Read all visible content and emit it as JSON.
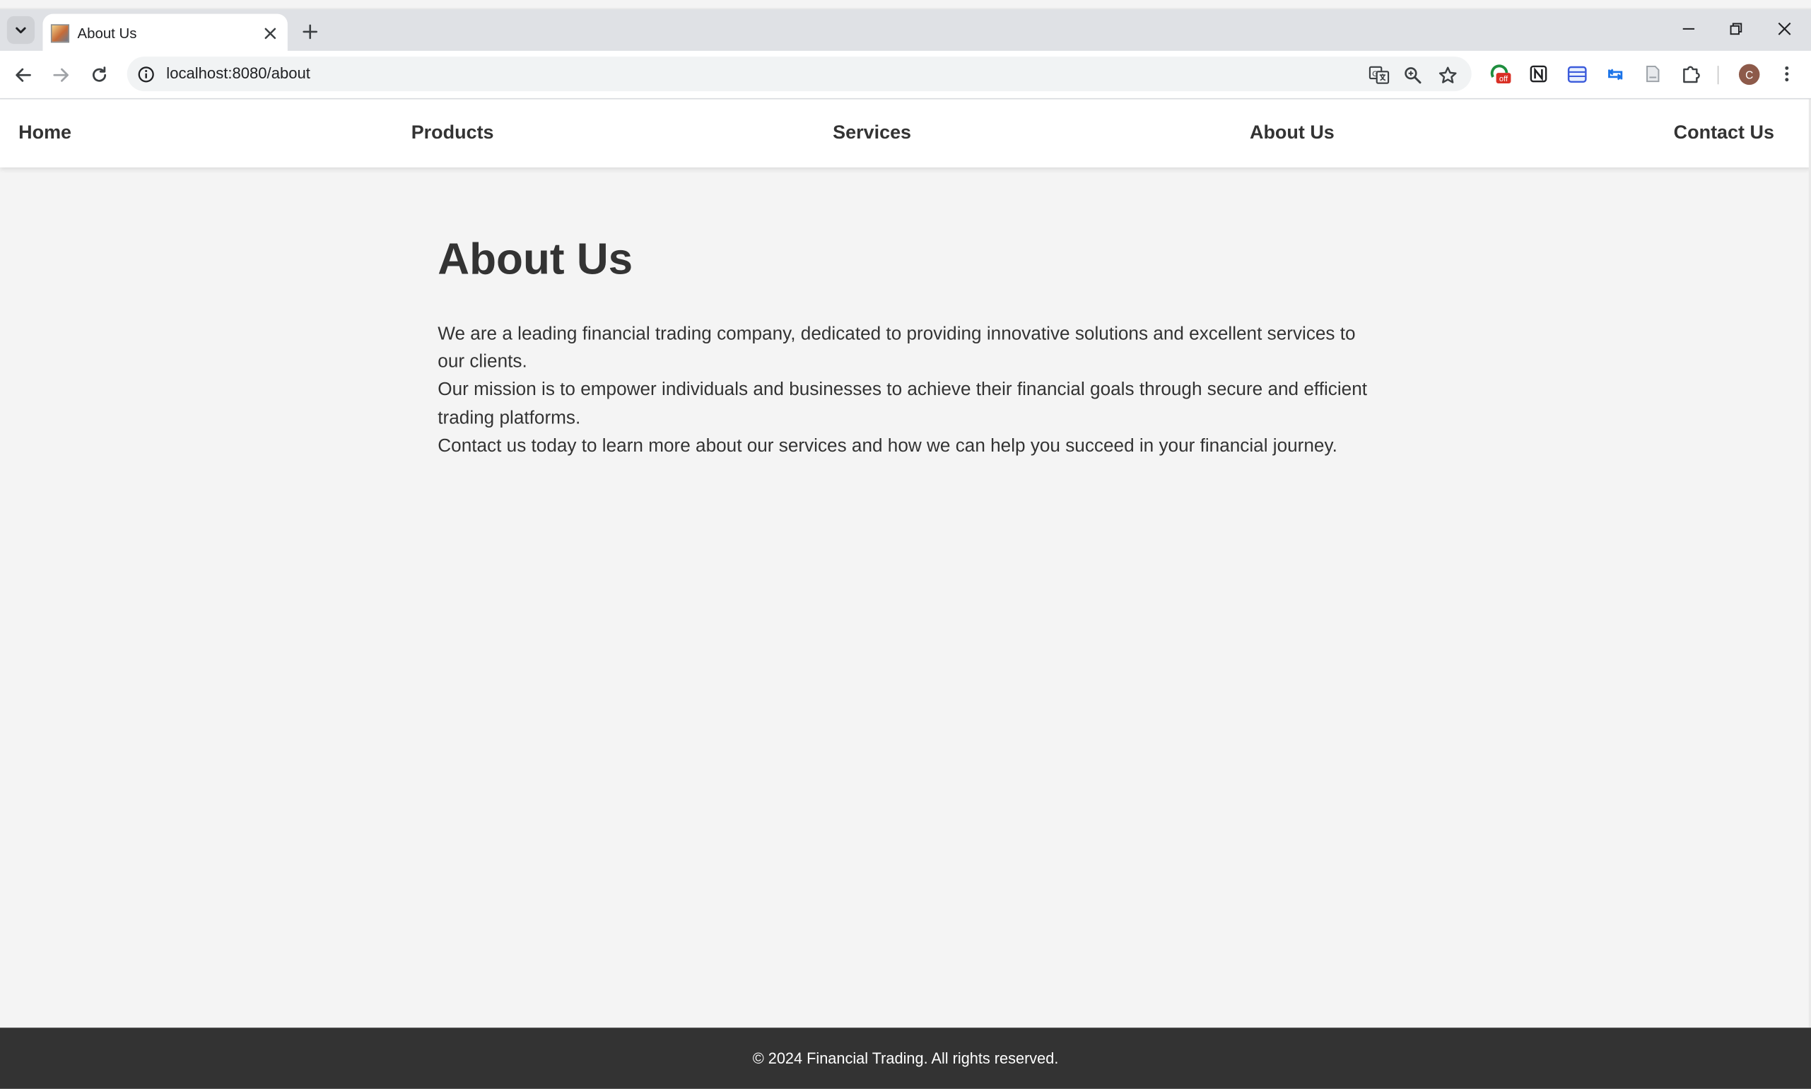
{
  "browser": {
    "tab": {
      "title": "About Us"
    },
    "address_bar": {
      "url": "localhost:8080/about"
    },
    "profile_initial": "C",
    "extension_badge": "off"
  },
  "site": {
    "nav": {
      "items": [
        {
          "label": "Home"
        },
        {
          "label": "Products"
        },
        {
          "label": "Services"
        },
        {
          "label": "About Us"
        },
        {
          "label": "Contact Us"
        }
      ]
    },
    "page": {
      "heading": "About Us",
      "paragraphs": [
        "We are a leading financial trading company, dedicated to providing innovative solutions and excellent services to our clients.",
        "Our mission is to empower individuals and businesses to achieve their financial goals through secure and efficient trading platforms.",
        "Contact us today to learn more about our services and how we can help you succeed in your financial journey."
      ]
    },
    "footer": {
      "text": "© 2024 Financial Trading. All rights reserved."
    }
  },
  "colors": {
    "page_background": "#f4f4f4",
    "nav_background": "#ffffff",
    "text": "#333333",
    "footer_background": "#333333",
    "footer_text": "#ffffff"
  }
}
